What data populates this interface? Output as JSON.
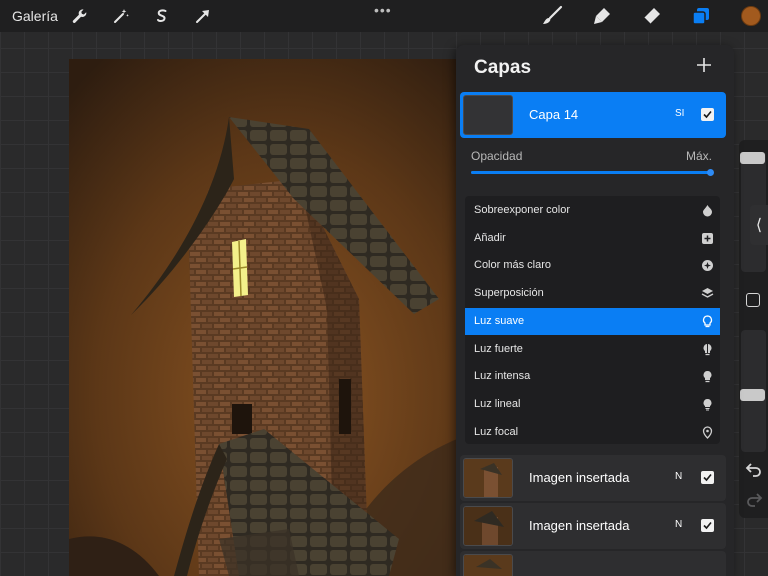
{
  "topbar": {
    "gallery_label": "Galería",
    "more_label": "•••",
    "color_current": "#a25a1e"
  },
  "layers_panel": {
    "title": "Capas",
    "active_layer": {
      "name": "Capa 14",
      "blend_code": "SI",
      "visible": true
    },
    "opacity": {
      "label": "Opacidad",
      "max_label": "Máx.",
      "value": 1.0
    },
    "blend_modes": [
      {
        "label": "Sobreexponer color",
        "icon": "burn-icon",
        "selected": false
      },
      {
        "label": "Añadir",
        "icon": "add-square-icon",
        "selected": false
      },
      {
        "label": "Color más claro",
        "icon": "lighter-color-icon",
        "selected": false
      },
      {
        "label": "Superposición",
        "icon": "overlay-icon",
        "selected": false
      },
      {
        "label": "Luz suave",
        "icon": "lightbulb-icon",
        "selected": true
      },
      {
        "label": "Luz fuerte",
        "icon": "hard-light-icon",
        "selected": false
      },
      {
        "label": "Luz intensa",
        "icon": "vivid-light-icon",
        "selected": false
      },
      {
        "label": "Luz lineal",
        "icon": "linear-light-icon",
        "selected": false
      },
      {
        "label": "Luz focal",
        "icon": "pin-light-icon",
        "selected": false
      }
    ],
    "layers": [
      {
        "name": "Imagen insertada",
        "blend_code": "N",
        "visible": true
      },
      {
        "name": "Imagen insertada",
        "blend_code": "N",
        "visible": true
      },
      {
        "name": "",
        "blend_code": "",
        "visible": true
      }
    ]
  },
  "colors": {
    "accent": "#0a7ef4",
    "panel_bg": "#262628",
    "canvas_bg": "#2a2a2b"
  }
}
